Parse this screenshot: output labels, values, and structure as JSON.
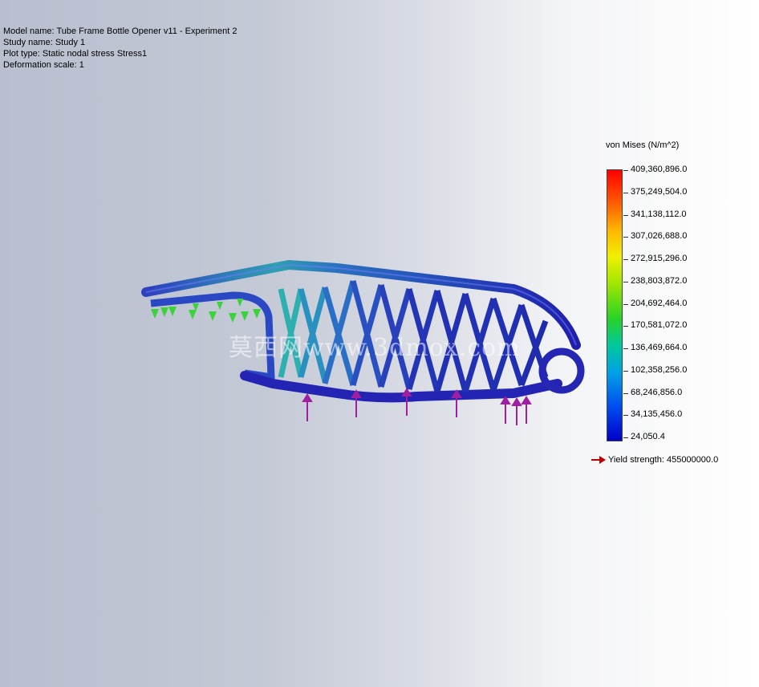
{
  "info": {
    "model_name": "Model name: Tube Frame Bottle Opener v11 - Experiment 2",
    "study_name": "Study name: Study 1",
    "plot_type": "Plot type: Static nodal stress Stress1",
    "deformation": "Deformation scale: 1"
  },
  "legend": {
    "title": "von Mises (N/m^2)",
    "labels": [
      "409,360,896.0",
      "375,249,504.0",
      "341,138,112.0",
      "307,026,688.0",
      "272,915,296.0",
      "238,803,872.0",
      "204,692,464.0",
      "170,581,072.0",
      "136,469,664.0",
      "102,358,256.0",
      "68,246,856.0",
      "34,135,456.0",
      "24,050.4"
    ],
    "yield": "Yield strength: 455000000.0"
  },
  "watermark": "莫西网www.3dmox.com",
  "colors": {
    "frame_blue": "#2a2ab8",
    "frame_cyan": "#2aa0a0",
    "fixture_green": "#3cd23c",
    "load_magenta": "#a01ea0",
    "yield_arrow": "#c00000"
  }
}
